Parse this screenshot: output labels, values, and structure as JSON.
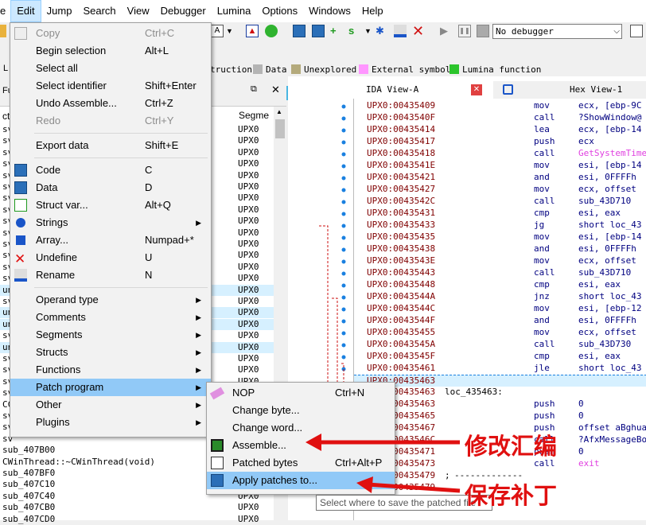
{
  "menubar": [
    "e",
    "Edit",
    "Jump",
    "Search",
    "View",
    "Debugger",
    "Lumina",
    "Options",
    "Windows",
    "Help"
  ],
  "debugger_select": "No debugger",
  "legend": [
    {
      "label": "truction",
      "color": "#c8c8c8"
    },
    {
      "label": "Data",
      "color": "#b4b4b4"
    },
    {
      "label": "Unexplored",
      "color": "#b4aa7c"
    },
    {
      "label": "External symbol",
      "color": "#ff96ff"
    },
    {
      "label": "Lumina function",
      "color": "#2cc52c"
    }
  ],
  "funcs_panel": {
    "title_partial": "Fu",
    "col_name": "ct",
    "col_segment": "Segme",
    "rows": [
      {
        "name": "sv",
        "seg": "UPX0"
      },
      {
        "name": "sv",
        "seg": "UPX0"
      },
      {
        "name": "sv",
        "seg": "UPX0"
      },
      {
        "name": "sv",
        "seg": "UPX0"
      },
      {
        "name": "sv",
        "seg": "UPX0"
      },
      {
        "name": "sv",
        "seg": "UPX0"
      },
      {
        "name": "sv",
        "seg": "UPX0"
      },
      {
        "name": "sv",
        "seg": "UPX0"
      },
      {
        "name": "sv",
        "seg": "UPX0"
      },
      {
        "name": "sv",
        "seg": "UPX0"
      },
      {
        "name": "sv",
        "seg": "UPX0"
      },
      {
        "name": "sv",
        "seg": "UPX0"
      },
      {
        "name": "sv",
        "seg": "UPX0"
      },
      {
        "name": "sv",
        "seg": "UPX0"
      },
      {
        "name": "un",
        "seg": "UPX0"
      },
      {
        "name": "sv",
        "seg": "UPX0"
      },
      {
        "name": "un",
        "seg": "UPX0"
      },
      {
        "name": "un",
        "seg": "UPX0"
      },
      {
        "name": "sv",
        "seg": "UPX0"
      },
      {
        "name": "un",
        "seg": "UPX0"
      },
      {
        "name": "sv",
        "seg": "UPX0"
      },
      {
        "name": "sv",
        "seg": "UPX0"
      },
      {
        "name": "sv",
        "seg": "UPX0"
      },
      {
        "name": "sv",
        "seg": "UPX0"
      },
      {
        "name": "CC",
        "seg": "UPX0"
      },
      {
        "name": "sv",
        "seg": "UPX0"
      },
      {
        "name": "sv",
        "seg": "UPX0"
      },
      {
        "name": "sv",
        "seg": "UPX0"
      },
      {
        "name": "sub_407B00",
        "seg": "UPX0"
      },
      {
        "name": "CWinThread::~CWinThread(void)",
        "seg": "UPX0"
      },
      {
        "name": "sub_407BF0",
        "seg": "UPX0"
      },
      {
        "name": "sub_407C10",
        "seg": "UPX0"
      },
      {
        "name": "sub_407C40",
        "seg": "UPX0"
      },
      {
        "name": "sub_407CB0",
        "seg": "UPX0"
      },
      {
        "name": "sub_407CD0",
        "seg": "UPX0"
      }
    ]
  },
  "ida_tabs": {
    "ida_view": "IDA View-A",
    "hex_view": "Hex View-1"
  },
  "code_rows": [
    {
      "addr": "UPX0:00435409",
      "mn": "mov",
      "op": "ecx, [ebp-9C"
    },
    {
      "addr": "UPX0:0043540F",
      "mn": "call",
      "op": "?ShowWindow@"
    },
    {
      "addr": "UPX0:00435414",
      "mn": "lea",
      "op": "ecx, [ebp-14"
    },
    {
      "addr": "UPX0:00435417",
      "mn": "push",
      "op": "ecx"
    },
    {
      "addr": "UPX0:00435418",
      "mn": "call",
      "op": "GetSystemTime",
      "pink": true
    },
    {
      "addr": "UPX0:0043541E",
      "mn": "mov",
      "op": "esi, [ebp-14"
    },
    {
      "addr": "UPX0:00435421",
      "mn": "and",
      "op": "esi, 0FFFFh"
    },
    {
      "addr": "UPX0:00435427",
      "mn": "mov",
      "op": "ecx, offset "
    },
    {
      "addr": "UPX0:0043542C",
      "mn": "call",
      "op": "sub_43D710"
    },
    {
      "addr": "UPX0:00435431",
      "mn": "cmp",
      "op": "esi, eax"
    },
    {
      "addr": "UPX0:00435433",
      "mn": "jg",
      "op": "short loc_43"
    },
    {
      "addr": "UPX0:00435435",
      "mn": "mov",
      "op": "esi, [ebp-14"
    },
    {
      "addr": "UPX0:00435438",
      "mn": "and",
      "op": "esi, 0FFFFh"
    },
    {
      "addr": "UPX0:0043543E",
      "mn": "mov",
      "op": "ecx, offset "
    },
    {
      "addr": "UPX0:00435443",
      "mn": "call",
      "op": "sub_43D710"
    },
    {
      "addr": "UPX0:00435448",
      "mn": "cmp",
      "op": "esi, eax"
    },
    {
      "addr": "UPX0:0043544A",
      "mn": "jnz",
      "op": "short loc_43"
    },
    {
      "addr": "UPX0:0043544C",
      "mn": "mov",
      "op": "esi, [ebp-12"
    },
    {
      "addr": "UPX0:0043544F",
      "mn": "and",
      "op": "esi, 0FFFFh"
    },
    {
      "addr": "UPX0:00435455",
      "mn": "mov",
      "op": "ecx, offset "
    },
    {
      "addr": "UPX0:0043545A",
      "mn": "call",
      "op": "sub_43D730"
    },
    {
      "addr": "UPX0:0043545F",
      "mn": "cmp",
      "op": "esi, eax"
    },
    {
      "addr": "UPX0:00435461",
      "mn": "jle",
      "op": "short loc_43"
    },
    {
      "addr": "UPX0:00435463",
      "mn": "",
      "op": "",
      "sel": true
    },
    {
      "addr": "UPX0:00435463",
      "mn": "loc_435463:",
      "op": "",
      "label": true
    },
    {
      "addr": "UPX0:00435463",
      "mn": "push",
      "op": "0"
    },
    {
      "addr": "UPX0:00435465",
      "mn": "push",
      "op": "0"
    },
    {
      "addr": "UPX0:00435467",
      "mn": "push",
      "op": "offset aBghua"
    },
    {
      "addr": "UPX0:0043546C",
      "mn": "call",
      "op": "?AfxMessageBo"
    },
    {
      "addr": "UPX0:00435471",
      "mn": "push",
      "op": "0"
    },
    {
      "addr": "UPX0:00435473",
      "mn": "call",
      "op": "exit",
      "pink": true
    },
    {
      "addr": "UPX0:00435479",
      "mn": ";",
      "op": "-------------"
    },
    {
      "addr": "UPX0:00435479",
      "mn": "",
      "op": ""
    }
  ],
  "edit_menu": [
    {
      "label": "Copy",
      "shortcut": "Ctrl+C",
      "disabled": true,
      "icon": "copy-icon"
    },
    {
      "label": "Begin selection",
      "shortcut": "Alt+L"
    },
    {
      "label": "Select all",
      "shortcut": ""
    },
    {
      "label": "Select identifier",
      "shortcut": "Shift+Enter"
    },
    {
      "label": "Undo Assemble...",
      "shortcut": "Ctrl+Z"
    },
    {
      "label": "Redo",
      "shortcut": "Ctrl+Y",
      "disabled": true
    },
    {
      "sep": true
    },
    {
      "label": "Export data",
      "shortcut": "Shift+E"
    },
    {
      "sep": true
    },
    {
      "label": "Code",
      "shortcut": "C",
      "icon": "code-icon"
    },
    {
      "label": "Data",
      "shortcut": "D",
      "icon": "data-icon"
    },
    {
      "label": "Struct var...",
      "shortcut": "Alt+Q",
      "icon": "struct-var-icon"
    },
    {
      "label": "Strings",
      "shortcut": "",
      "submenu": true,
      "icon": "strings-icon"
    },
    {
      "label": "Array...",
      "shortcut": "Numpad+*",
      "icon": "array-icon"
    },
    {
      "label": "Undefine",
      "shortcut": "U",
      "icon": "undefine-icon"
    },
    {
      "label": "Rename",
      "shortcut": "N",
      "icon": "rename-icon"
    },
    {
      "sep": true
    },
    {
      "label": "Operand type",
      "submenu": true
    },
    {
      "label": "Comments",
      "submenu": true
    },
    {
      "label": "Segments",
      "submenu": true
    },
    {
      "label": "Structs",
      "submenu": true
    },
    {
      "label": "Functions",
      "submenu": true
    },
    {
      "label": "Patch program",
      "submenu": true,
      "highlight": true
    },
    {
      "label": "Other",
      "submenu": true
    },
    {
      "label": "Plugins",
      "submenu": true
    }
  ],
  "patch_menu": [
    {
      "label": "NOP",
      "shortcut": "Ctrl+N",
      "icon": "eraser-icon"
    },
    {
      "label": "Change byte...",
      "shortcut": ""
    },
    {
      "label": "Change word...",
      "shortcut": ""
    },
    {
      "label": "Assemble...",
      "shortcut": "",
      "icon": "chip-icon"
    },
    {
      "label": "Patched bytes",
      "shortcut": "Ctrl+Alt+P",
      "icon": "patched-bytes-icon"
    },
    {
      "label": "Apply patches to...",
      "shortcut": "",
      "icon": "floppy-icon",
      "highlight": true
    }
  ],
  "tooltip": "Select where to save the patched file",
  "annotations": {
    "assemble": "修改汇编",
    "apply": "保存补丁"
  },
  "colors": {
    "arrow": "#e01010",
    "nav": "#1f8fe6",
    "highlight": "#91c9f7"
  }
}
